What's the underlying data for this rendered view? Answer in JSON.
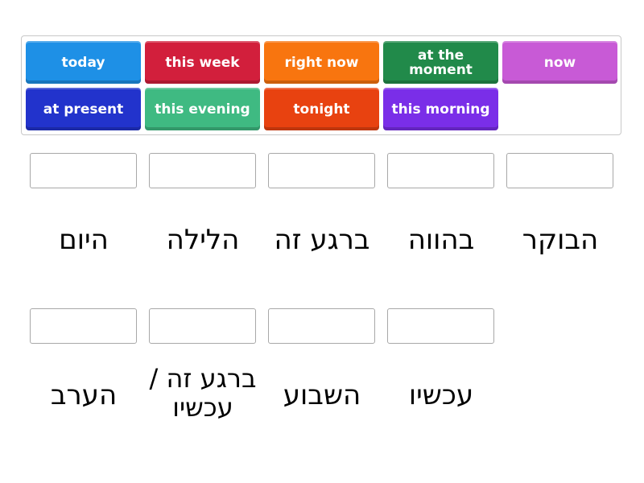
{
  "tiles": [
    {
      "label": "today",
      "color": "#1e90e6"
    },
    {
      "label": "this week",
      "color": "#d21f3c"
    },
    {
      "label": "right now",
      "color": "#f8750f"
    },
    {
      "label": "at the moment",
      "color": "#218a4a"
    },
    {
      "label": "now",
      "color": "#c85ad6"
    },
    {
      "label": "at present",
      "color": "#2233cc"
    },
    {
      "label": "this evening",
      "color": "#3fba82"
    },
    {
      "label": "tonight",
      "color": "#e84210"
    },
    {
      "label": "this morning",
      "color": "#7a2ee8"
    }
  ],
  "targets": [
    {
      "label": "היום"
    },
    {
      "label": "הלילה"
    },
    {
      "label": "ברגע זה"
    },
    {
      "label": "בהווה"
    },
    {
      "label": "הבוקר"
    },
    {
      "label": "הערב"
    },
    {
      "label": "ברגע זה / עכשיו"
    },
    {
      "label": "השבוע"
    },
    {
      "label": "עכשיו"
    }
  ]
}
